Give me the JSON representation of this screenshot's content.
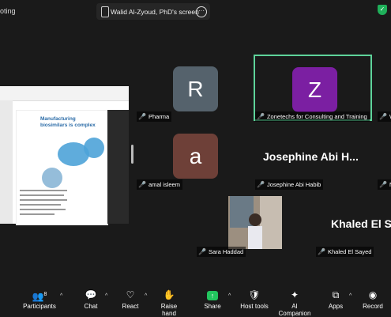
{
  "top_bar": {
    "left_text": "oting",
    "share_label": "Walid Al-Zyoud, PhD's screen",
    "more_glyph": "···"
  },
  "shared_screen": {
    "slide_title": "Manufacturing biosimilars is complex"
  },
  "participants": [
    {
      "initial": "R",
      "name": "Pharma",
      "avatar_color": "#55626c"
    },
    {
      "initial": "Z",
      "name": "Zonetechs for Consulting and Training",
      "avatar_color": "#7b1fa2",
      "active_speaker": true
    },
    {
      "initial": "",
      "name": "W",
      "partial": true
    },
    {
      "initial": "a",
      "name": "amal isleem",
      "avatar_color": "#6e4038"
    },
    {
      "display_name": "Josephine  Abi  H...",
      "name": "Josephine Abi Habib"
    },
    {
      "initial": "",
      "name": "Ni",
      "partial": true
    },
    {
      "name": "Sara Haddad",
      "video": true
    },
    {
      "display_name": "Khaled El S",
      "name": "Khaled El Sayed"
    }
  ],
  "toolbar": {
    "participants_label": "Participants",
    "participants_count": "8",
    "chat_label": "Chat",
    "react_label": "React",
    "raise_hand_label": "Raise hand",
    "share_label": "Share",
    "host_tools_label": "Host tools",
    "ai_companion_label": "AI Companion",
    "apps_label": "Apps",
    "record_label": "Record",
    "share_color": "#22c55e"
  }
}
